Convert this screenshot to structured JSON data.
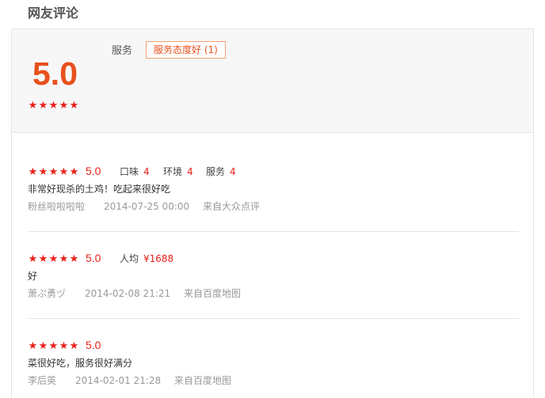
{
  "section_title": "网友评论",
  "summary": {
    "score": "5.0",
    "stars": 5,
    "category_label": "服务",
    "tag": "服务态度好 (1)"
  },
  "reviews": [
    {
      "stars": 5,
      "score": "5.0",
      "subs": [
        {
          "label": "口味",
          "value": "4"
        },
        {
          "label": "环境",
          "value": "4"
        },
        {
          "label": "服务",
          "value": "4"
        }
      ],
      "text": "非常好现杀的土鸡！吃起来很好吃",
      "author": "粉丝啦啦啦啦",
      "date": "2014-07-25 00:00",
      "source": "来自大众点评"
    },
    {
      "stars": 5,
      "score": "5.0",
      "subs": [
        {
          "label": "人均",
          "value": "¥1688"
        }
      ],
      "text": "好",
      "author": "萧ぷ勇ヅ",
      "date": "2014-02-08 21:21",
      "source": "来自百度地图"
    },
    {
      "stars": 5,
      "score": "5.0",
      "subs": [],
      "text": "菜很好吃，服务很好满分",
      "author": "李后英",
      "date": "2014-02-01 21:28",
      "source": "来自百度地图"
    }
  ],
  "colors": {
    "accent": "#e8501d",
    "star": "#e8211a",
    "tag_border": "#f4a36f"
  }
}
